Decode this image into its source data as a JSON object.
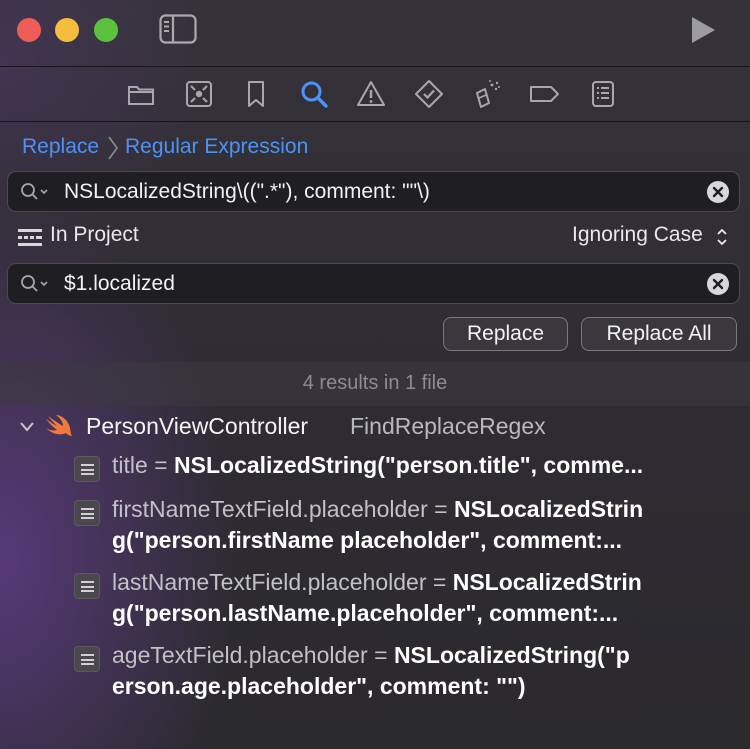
{
  "toolbar": {
    "icons": [
      "close-window",
      "minimize-window",
      "zoom-window",
      "sidebar-toggle",
      "run-play"
    ]
  },
  "navigator_tabs": [
    "folder-icon",
    "source-control-icon",
    "bookmark-icon",
    "search-icon",
    "warning-icon",
    "test-icon",
    "debug-icon",
    "breakpoint-icon",
    "report-icon"
  ],
  "breadcrumb": {
    "mode": "Replace",
    "style": "Regular Expression"
  },
  "find": {
    "query": "NSLocalizedString\\((\".*\"), comment: \"\"\\)"
  },
  "scope": {
    "label": "In Project",
    "case": "Ignoring Case"
  },
  "replace": {
    "value": "$1.localized"
  },
  "buttons": {
    "replace": "Replace",
    "replace_all": "Replace All"
  },
  "results": {
    "summary": "4 results in 1 file",
    "file": {
      "name": "PersonViewController",
      "project": "FindReplaceRegex"
    },
    "matches": [
      {
        "lines": [
          {
            "plain": "title = ",
            "bold": "NSLocalizedString(\"person.title\", comme..."
          }
        ]
      },
      {
        "lines": [
          {
            "plain": "firstNameTextField.placeholder = ",
            "bold": "NSLocalizedStrin"
          },
          {
            "plain": "",
            "bold": "g(\"person.firstName placeholder\", comment:..."
          }
        ]
      },
      {
        "lines": [
          {
            "plain": "lastNameTextField.placeholder = ",
            "bold": "NSLocalizedStrin"
          },
          {
            "plain": "",
            "bold": "g(\"person.lastName.placeholder\", comment:..."
          }
        ]
      },
      {
        "lines": [
          {
            "plain": "ageTextField.placeholder = ",
            "bold": "NSLocalizedString(\"p"
          },
          {
            "plain": "",
            "bold": "erson.age.placeholder\", comment: \"\")"
          }
        ]
      }
    ]
  },
  "colors": {
    "accent": "#4d93f5",
    "close": "#ee5d57",
    "minimize": "#f5bd3b",
    "zoom": "#5cc23d"
  }
}
